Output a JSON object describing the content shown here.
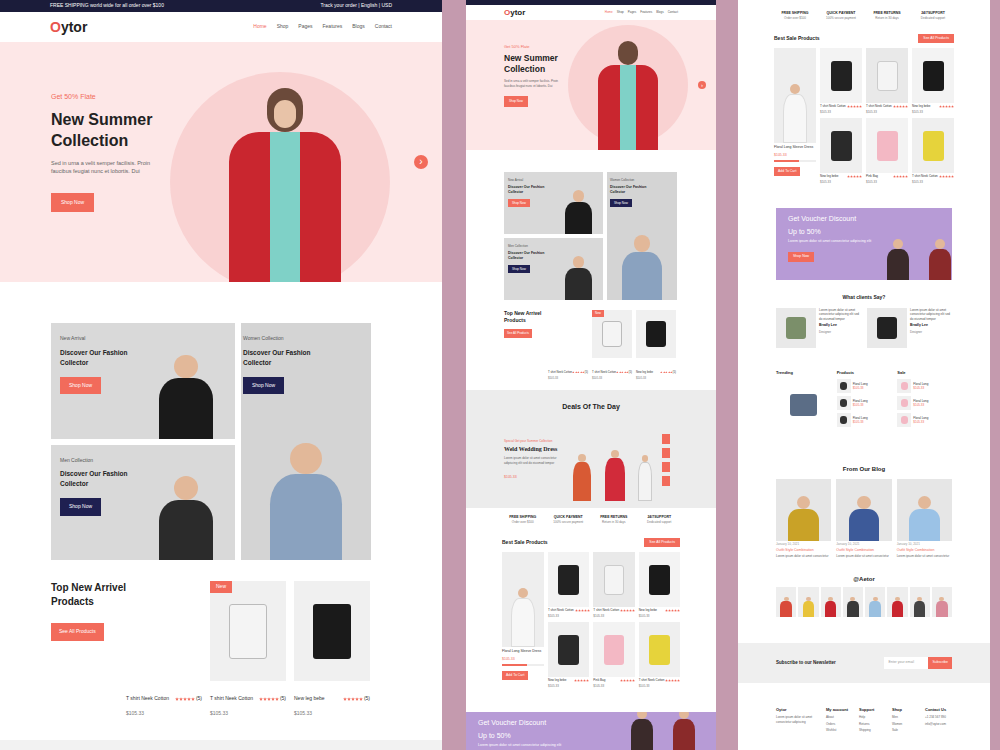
{
  "topbar": {
    "promo": "FREE SHIPPING world wide for all order over $100",
    "links": "Track your order | English | USD"
  },
  "logo": {
    "initial": "O",
    "rest": "ytor"
  },
  "nav": [
    {
      "label": "Home",
      "selected": true
    },
    {
      "label": "Shop",
      "selected": false
    },
    {
      "label": "Pages",
      "selected": false
    },
    {
      "label": "Features",
      "selected": false
    },
    {
      "label": "Blogs",
      "selected": false
    },
    {
      "label": "Contact",
      "selected": false
    }
  ],
  "hero": {
    "kicker": "Get 50% Flate",
    "title": "New Summer Collection",
    "text": "Sed in urna a velit semper facilisis. Proin faucibus feugiat nunc et lobortis. Dui",
    "button": "Shop Now",
    "arrow": "›"
  },
  "collections": [
    {
      "kicker": "New Arrival",
      "title": "Discover Our Fashion Collector",
      "button": "Shop Now",
      "kind": "accent"
    },
    {
      "kicker": "Men Collection",
      "title": "Discover Our Fashion Collector",
      "button": "Shop Now",
      "kind": "dark"
    },
    {
      "kicker": "Women Collection",
      "title": "Discover Our Fashion Collector",
      "button": "Shop Now",
      "kind": "dark"
    }
  ],
  "arrivals": {
    "title": "Top New Arrivel Prodacts",
    "mobile_title": "Top New Arrivel Products",
    "button": "See All Products",
    "badge": "New",
    "products": [
      {
        "name": "T shirt Neek Cotton",
        "stars": 5,
        "count": "(5)",
        "price": "$105.33",
        "new": false
      },
      {
        "name": "T shirt Neek Cotton",
        "stars": 5,
        "count": "(5)",
        "price": "$105.33",
        "new": true
      },
      {
        "name": "New leg bebe",
        "stars": 5,
        "count": "(5)",
        "price": "$105.33",
        "new": false
      }
    ]
  },
  "deals": {
    "title": "Deals Of The Day",
    "kicker": "Special Get your Summer Collection",
    "name": "Weld Wedding Dress",
    "text": "Lorem ipsum dolor sit amet consectetur adipiscing elit sed do eiusmod tempor",
    "price": "$105.33"
  },
  "features": [
    {
      "title": "FREE SHIPPING",
      "text": "Order over $100"
    },
    {
      "title": "QUICK PAYMENT",
      "text": "100% secure payment"
    },
    {
      "title": "FREE RETURNS",
      "text": "Return in 30 days"
    },
    {
      "title": "24/7SUPPORT",
      "text": "Dedicated support"
    }
  ],
  "best_sale": {
    "title": "Best Sale Products",
    "button": "See All Products",
    "featured": {
      "name": "Floral Long Sleeve Dress",
      "price": "$105.33",
      "button": "Add To Cart"
    },
    "products": [
      {
        "name": "T shirt Neek Cotton",
        "price": "$105.33",
        "stars": 5
      },
      {
        "name": "T shirt Neek Cotton",
        "price": "$105.33",
        "stars": 5
      },
      {
        "name": "New leg bebe",
        "price": "$105.33",
        "stars": 5
      },
      {
        "name": "New leg bebe",
        "price": "$105.33",
        "stars": 5
      },
      {
        "name": "Pink Bag",
        "price": "$105.33",
        "stars": 5
      },
      {
        "name": "T shirt Neek Cotton",
        "price": "$105.33",
        "stars": 5
      }
    ]
  },
  "voucher": {
    "title": "Get Voucher Discount",
    "subtitle": "Up to 50%",
    "text": "Lorem ipsum dolor sit amet consectetur adipiscing elit",
    "button": "Shop Now"
  },
  "testimonials": {
    "title": "What clients Say?",
    "items": [
      {
        "quote": "Lorem ipsum dolor sit amet consectetur adipiscing elit sed do eiusmod tempor",
        "name": "Bradly Lee",
        "role": "Designer"
      },
      {
        "quote": "Lorem ipsum dolor sit amet consectetur adipiscing elit sed do eiusmod tempor",
        "name": "Bradly Lee",
        "role": "Designer"
      }
    ]
  },
  "lists": [
    {
      "title": "Trending",
      "kind": "photo",
      "items": []
    },
    {
      "title": "Products",
      "kind": "list",
      "items": [
        {
          "name": "Floral Long",
          "price": "$105.33"
        },
        {
          "name": "Floral Long",
          "price": "$105.33"
        },
        {
          "name": "Floral Long",
          "price": "$105.33"
        }
      ]
    },
    {
      "title": "Sale",
      "kind": "list",
      "items": [
        {
          "name": "Floral Long",
          "price": "$105.33"
        },
        {
          "name": "Floral Long",
          "price": "$105.33"
        },
        {
          "name": "Floral Long",
          "price": "$105.33"
        }
      ]
    }
  ],
  "blog": {
    "title": "From Our Blog",
    "posts": [
      {
        "date": "January 10, 2021",
        "title": "Outfit Style Combination",
        "text": "Lorem ipsum dolor sit amet consectetur"
      },
      {
        "date": "January 10, 2021",
        "title": "Outfit Style Combination",
        "text": "Lorem ipsum dolor sit amet consectetur"
      },
      {
        "date": "January 10, 2021",
        "title": "Outfit Style Combination",
        "text": "Lorem ipsum dolor sit amet consectetur"
      }
    ]
  },
  "instagram": {
    "title": "@Aetor"
  },
  "newsletter": {
    "title": "Subscribe to our Newsletter",
    "placeholder": "Enter your email",
    "button": "Subscribe"
  },
  "footer": {
    "brand": "Oytor",
    "text": "Lorem ipsum dolor sit amet consectetur adipiscing",
    "columns": [
      {
        "title": "My account",
        "links": [
          "About",
          "Orders",
          "Wishlist"
        ]
      },
      {
        "title": "Support",
        "links": [
          "Help",
          "Returns",
          "Shipping"
        ]
      },
      {
        "title": "Shop",
        "links": [
          "Men",
          "Women",
          "Sale"
        ]
      },
      {
        "title": "Contact Us",
        "links": [
          "+1 234 567 890",
          "info@oytor.com"
        ]
      }
    ]
  }
}
